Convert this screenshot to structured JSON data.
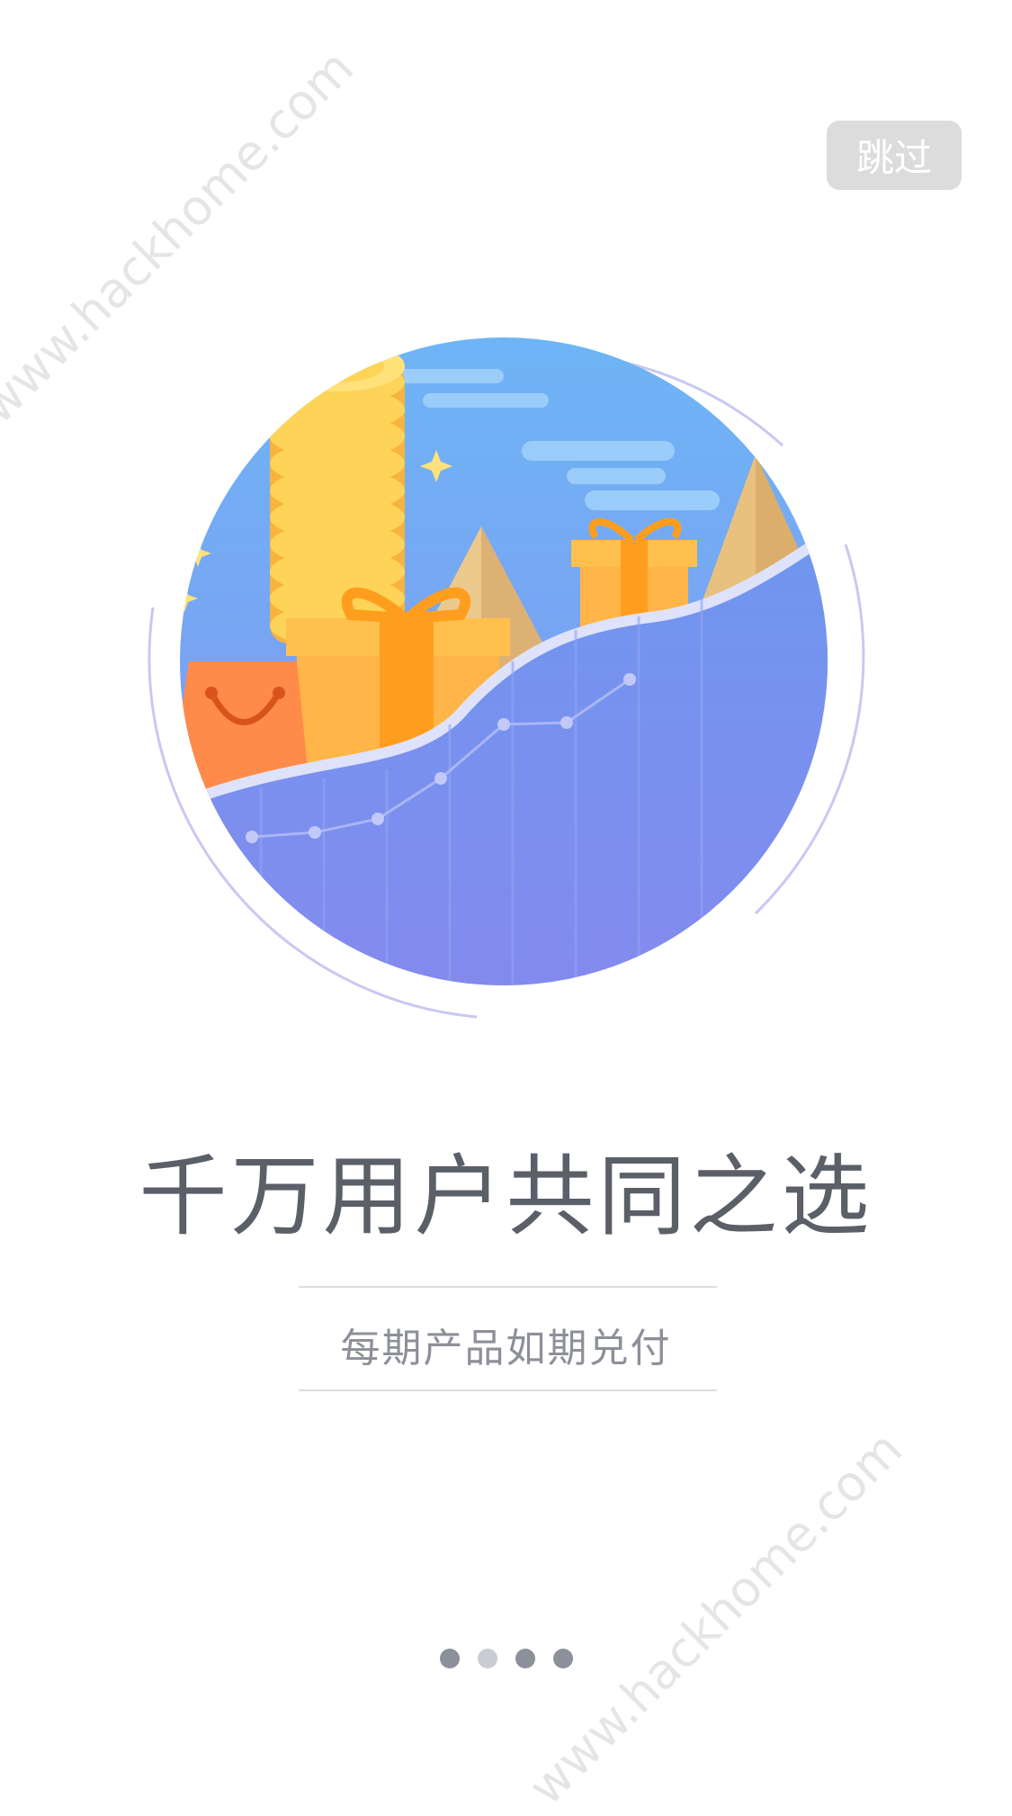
{
  "skip_label": "跳过",
  "headline": "千万用户共同之选",
  "subline": "每期产品如期兑付",
  "watermark": "www.hackhome.com",
  "pager": {
    "count": 4,
    "active_index": 1,
    "dot_color": "#8c909a",
    "active_dot_color": "#c9ccd2"
  },
  "colors": {
    "sky_top": "#69b4f5",
    "sky_bottom": "#8a8ff0",
    "ground": "#7b8eeb",
    "coin": "#fdd458",
    "gift": "#ffb547",
    "bag": "#ff8c4a",
    "pyramid": "#e6c38a"
  },
  "icons": {
    "illustration": "coins-gifts-growth-illustration"
  }
}
